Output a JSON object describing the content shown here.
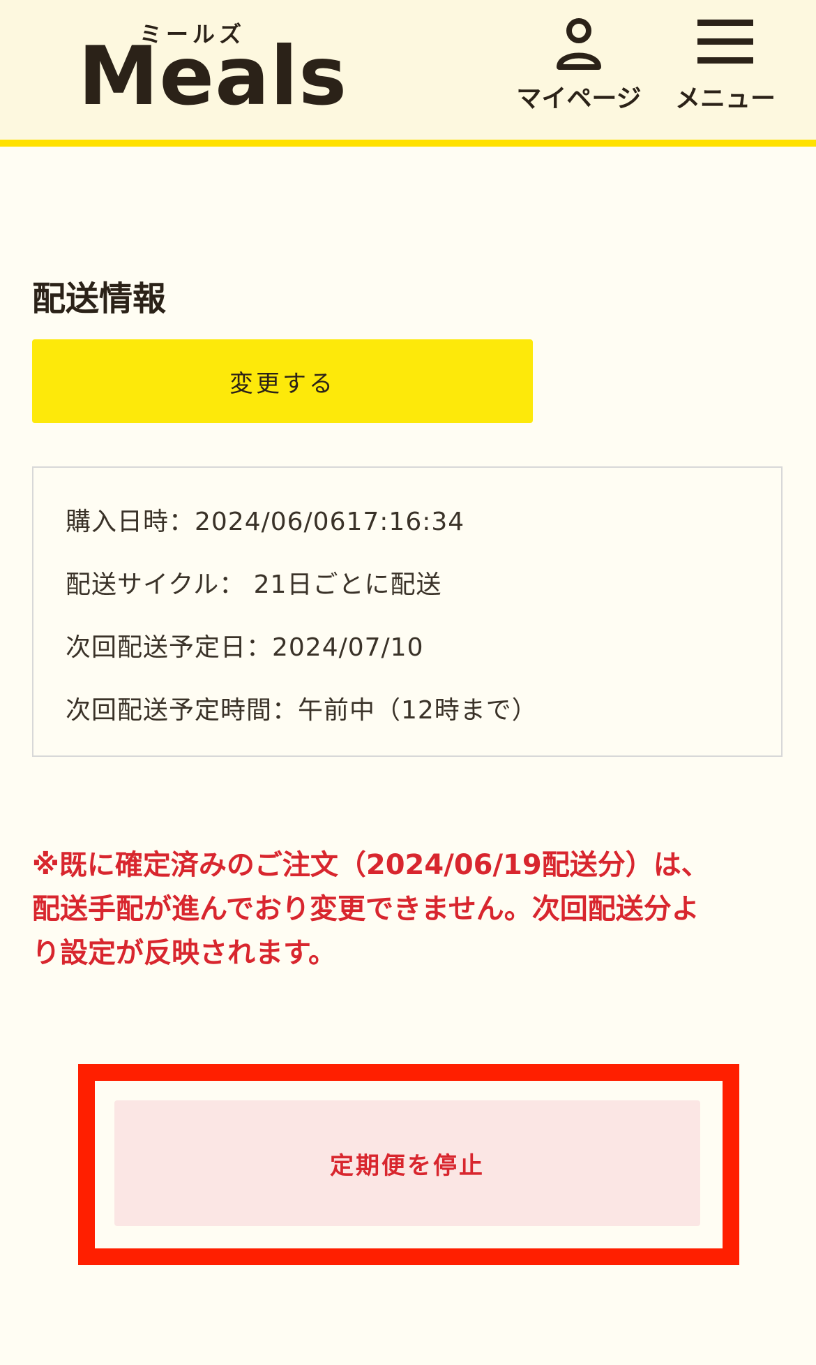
{
  "header": {
    "logo_kana": "ミールズ",
    "logo_word": "Meals",
    "mypage_label": "マイページ",
    "menu_label": "メニュー"
  },
  "icons": {
    "mypage": "user-icon",
    "menu": "hamburger-menu-icon"
  },
  "section": {
    "title": "配送情報",
    "change_button": "変更する"
  },
  "info": {
    "purchase_datetime": "購入日時：2024/06/0617:16:34",
    "delivery_cycle": "配送サイクル：  21日ごとに配送",
    "next_delivery_date": "次回配送予定日：2024/07/10",
    "next_delivery_time": "次回配送予定時間：午前中（12時まで）"
  },
  "notice": {
    "line1": "※既に確定済みのご注文（2024/06/19配送分）は、",
    "line2": "配送手配が進んでおり変更できません。次回配送分よ",
    "line3": "り設定が反映されます。"
  },
  "stop_button": "定期便を停止",
  "colors": {
    "accent_yellow": "#ffe100",
    "header_bg": "#fdf8df",
    "page_bg": "#fffdf3",
    "warning_red": "#d8262e",
    "highlight_red": "#ff1f00",
    "stop_button_bg": "#fbe6e4"
  }
}
